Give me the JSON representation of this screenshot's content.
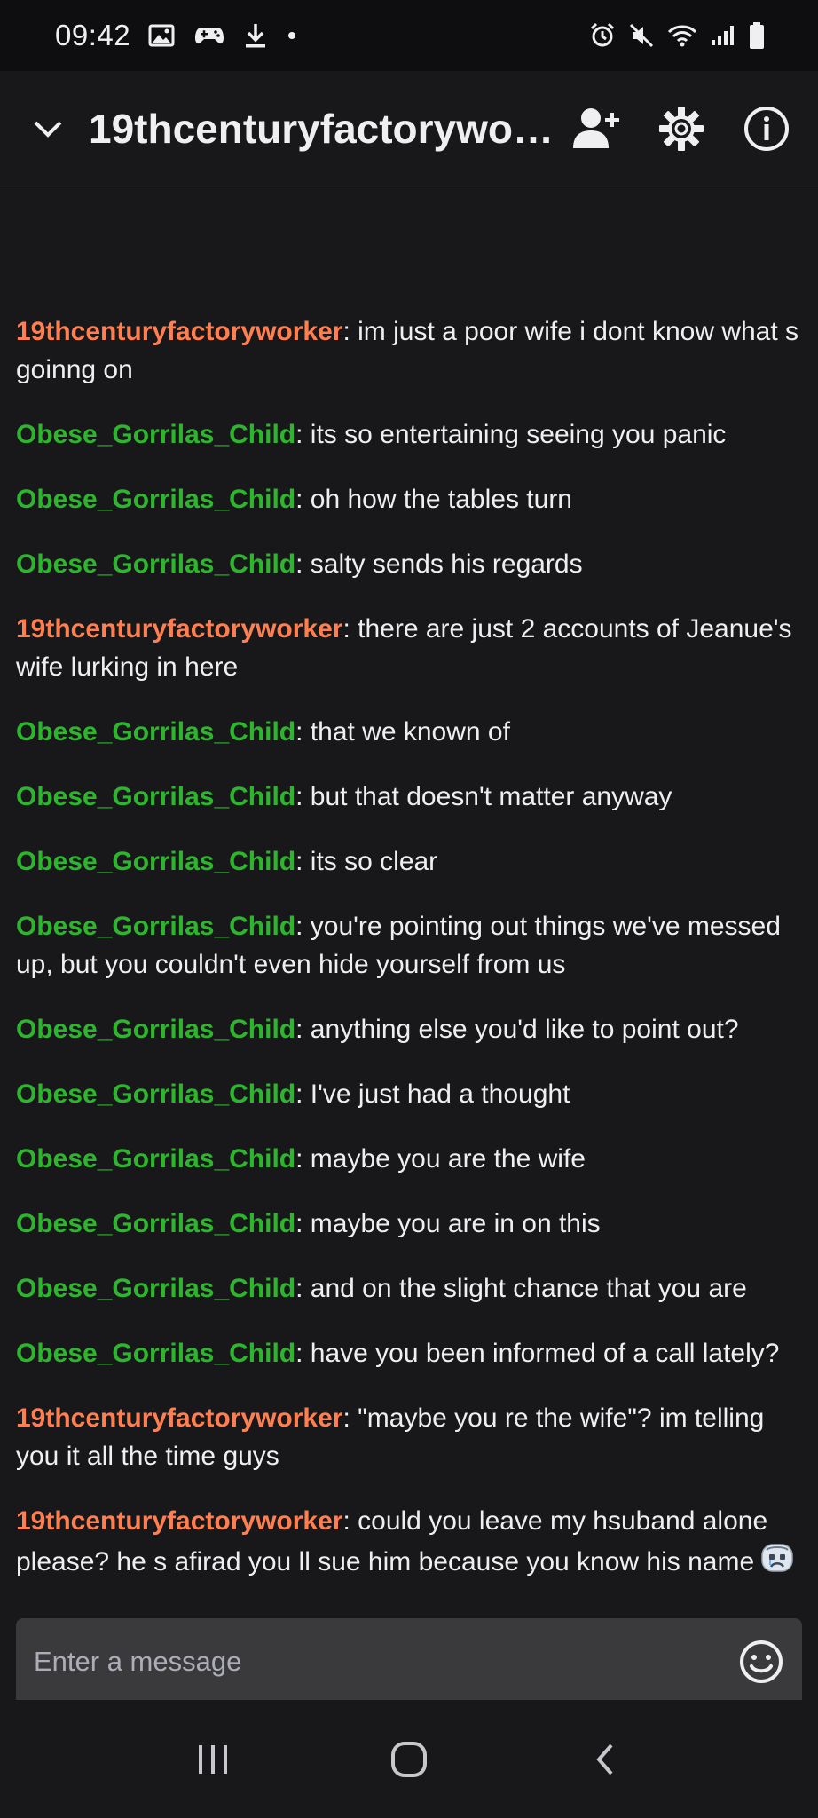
{
  "status_bar": {
    "time": "09:42"
  },
  "header": {
    "title": "19thcenturyfactoryworker",
    "icons": [
      "chevron-down-icon",
      "add-user-icon",
      "gear-icon",
      "info-icon"
    ]
  },
  "colors": {
    "green_user": "#2db52d",
    "orange_user": "#ff7f50",
    "background": "#18181b",
    "text": "#efeff1"
  },
  "chat": {
    "messages": [
      {
        "user": "19thcenturyfactoryworker",
        "color": "#ff7f50",
        "text": "im just a poor wife i dont know what s goinng on"
      },
      {
        "user": "Obese_Gorrilas_Child",
        "color": "#2db52d",
        "text": "its so entertaining seeing you panic"
      },
      {
        "user": "Obese_Gorrilas_Child",
        "color": "#2db52d",
        "text": "oh how the tables turn"
      },
      {
        "user": "Obese_Gorrilas_Child",
        "color": "#2db52d",
        "text": "salty sends his regards"
      },
      {
        "user": "19thcenturyfactoryworker",
        "color": "#ff7f50",
        "text": "there are just 2 accounts of Jeanue's wife lurking in here"
      },
      {
        "user": "Obese_Gorrilas_Child",
        "color": "#2db52d",
        "text": "that we known of"
      },
      {
        "user": "Obese_Gorrilas_Child",
        "color": "#2db52d",
        "text": "but that doesn't matter anyway"
      },
      {
        "user": "Obese_Gorrilas_Child",
        "color": "#2db52d",
        "text": "its so clear"
      },
      {
        "user": "Obese_Gorrilas_Child",
        "color": "#2db52d",
        "text": "you're pointing out things we've messed up, but you couldn't even hide yourself from us"
      },
      {
        "user": "Obese_Gorrilas_Child",
        "color": "#2db52d",
        "text": "anything else you'd like to point out?"
      },
      {
        "user": "Obese_Gorrilas_Child",
        "color": "#2db52d",
        "text": "I've just had a thought"
      },
      {
        "user": "Obese_Gorrilas_Child",
        "color": "#2db52d",
        "text": "maybe you are the wife"
      },
      {
        "user": "Obese_Gorrilas_Child",
        "color": "#2db52d",
        "text": "maybe you are in on this"
      },
      {
        "user": "Obese_Gorrilas_Child",
        "color": "#2db52d",
        "text": "and on the slight chance that you are"
      },
      {
        "user": "Obese_Gorrilas_Child",
        "color": "#2db52d",
        "text": "have you been informed of a call lately?"
      },
      {
        "user": "19thcenturyfactoryworker",
        "color": "#ff7f50",
        "text": "\"maybe you re the wife\"? im telling you it all the time guys"
      },
      {
        "user": "19thcenturyfactoryworker",
        "color": "#ff7f50",
        "text": "could you leave my hsuband alone please? he s afirad you ll sue him because you know his name",
        "emote": "sad-face-emote"
      }
    ]
  },
  "input": {
    "placeholder": "Enter a message",
    "value": ""
  }
}
